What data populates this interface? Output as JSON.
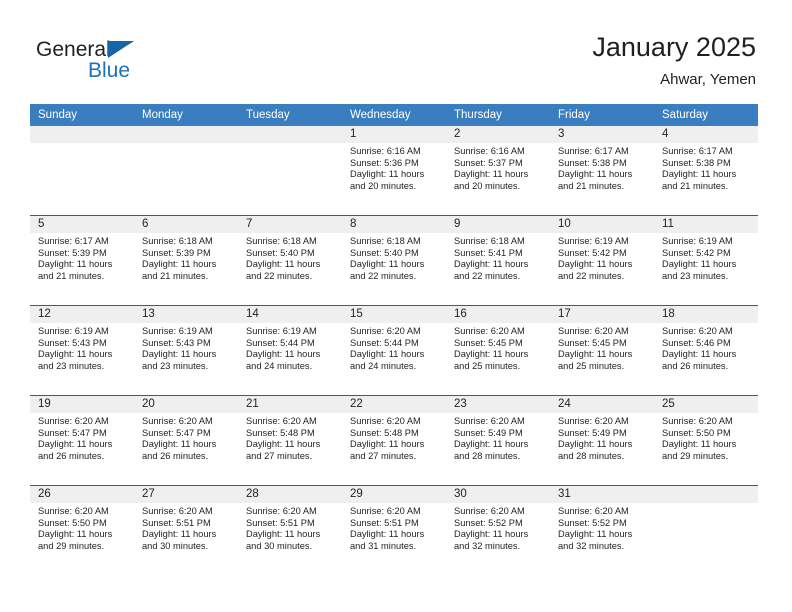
{
  "brand": {
    "name_part1": "General",
    "name_part2": "Blue",
    "triangle_icon": "triangle-icon"
  },
  "header": {
    "title": "January 2025",
    "location": "Ahwar, Yemen"
  },
  "colors": {
    "header_blue": "#3a7ec0",
    "rule_blue": "#1565a8",
    "band_gray": "#efefef",
    "text": "#231f20",
    "brand_blue": "#1d71b8"
  },
  "weekdays": [
    "Sunday",
    "Monday",
    "Tuesday",
    "Wednesday",
    "Thursday",
    "Friday",
    "Saturday"
  ],
  "calendar_data": {
    "month": "January",
    "year": 2025,
    "location": "Ahwar, Yemen",
    "weeks": [
      [
        {
          "day": "",
          "lines": [
            "",
            "",
            "",
            ""
          ]
        },
        {
          "day": "",
          "lines": [
            "",
            "",
            "",
            ""
          ]
        },
        {
          "day": "",
          "lines": [
            "",
            "",
            "",
            ""
          ]
        },
        {
          "day": "1",
          "lines": [
            "Sunrise: 6:16 AM",
            "Sunset: 5:36 PM",
            "Daylight: 11 hours",
            "and 20 minutes."
          ]
        },
        {
          "day": "2",
          "lines": [
            "Sunrise: 6:16 AM",
            "Sunset: 5:37 PM",
            "Daylight: 11 hours",
            "and 20 minutes."
          ]
        },
        {
          "day": "3",
          "lines": [
            "Sunrise: 6:17 AM",
            "Sunset: 5:38 PM",
            "Daylight: 11 hours",
            "and 21 minutes."
          ]
        },
        {
          "day": "4",
          "lines": [
            "Sunrise: 6:17 AM",
            "Sunset: 5:38 PM",
            "Daylight: 11 hours",
            "and 21 minutes."
          ]
        }
      ],
      [
        {
          "day": "5",
          "lines": [
            "Sunrise: 6:17 AM",
            "Sunset: 5:39 PM",
            "Daylight: 11 hours",
            "and 21 minutes."
          ]
        },
        {
          "day": "6",
          "lines": [
            "Sunrise: 6:18 AM",
            "Sunset: 5:39 PM",
            "Daylight: 11 hours",
            "and 21 minutes."
          ]
        },
        {
          "day": "7",
          "lines": [
            "Sunrise: 6:18 AM",
            "Sunset: 5:40 PM",
            "Daylight: 11 hours",
            "and 22 minutes."
          ]
        },
        {
          "day": "8",
          "lines": [
            "Sunrise: 6:18 AM",
            "Sunset: 5:40 PM",
            "Daylight: 11 hours",
            "and 22 minutes."
          ]
        },
        {
          "day": "9",
          "lines": [
            "Sunrise: 6:18 AM",
            "Sunset: 5:41 PM",
            "Daylight: 11 hours",
            "and 22 minutes."
          ]
        },
        {
          "day": "10",
          "lines": [
            "Sunrise: 6:19 AM",
            "Sunset: 5:42 PM",
            "Daylight: 11 hours",
            "and 22 minutes."
          ]
        },
        {
          "day": "11",
          "lines": [
            "Sunrise: 6:19 AM",
            "Sunset: 5:42 PM",
            "Daylight: 11 hours",
            "and 23 minutes."
          ]
        }
      ],
      [
        {
          "day": "12",
          "lines": [
            "Sunrise: 6:19 AM",
            "Sunset: 5:43 PM",
            "Daylight: 11 hours",
            "and 23 minutes."
          ]
        },
        {
          "day": "13",
          "lines": [
            "Sunrise: 6:19 AM",
            "Sunset: 5:43 PM",
            "Daylight: 11 hours",
            "and 23 minutes."
          ]
        },
        {
          "day": "14",
          "lines": [
            "Sunrise: 6:19 AM",
            "Sunset: 5:44 PM",
            "Daylight: 11 hours",
            "and 24 minutes."
          ]
        },
        {
          "day": "15",
          "lines": [
            "Sunrise: 6:20 AM",
            "Sunset: 5:44 PM",
            "Daylight: 11 hours",
            "and 24 minutes."
          ]
        },
        {
          "day": "16",
          "lines": [
            "Sunrise: 6:20 AM",
            "Sunset: 5:45 PM",
            "Daylight: 11 hours",
            "and 25 minutes."
          ]
        },
        {
          "day": "17",
          "lines": [
            "Sunrise: 6:20 AM",
            "Sunset: 5:45 PM",
            "Daylight: 11 hours",
            "and 25 minutes."
          ]
        },
        {
          "day": "18",
          "lines": [
            "Sunrise: 6:20 AM",
            "Sunset: 5:46 PM",
            "Daylight: 11 hours",
            "and 26 minutes."
          ]
        }
      ],
      [
        {
          "day": "19",
          "lines": [
            "Sunrise: 6:20 AM",
            "Sunset: 5:47 PM",
            "Daylight: 11 hours",
            "and 26 minutes."
          ]
        },
        {
          "day": "20",
          "lines": [
            "Sunrise: 6:20 AM",
            "Sunset: 5:47 PM",
            "Daylight: 11 hours",
            "and 26 minutes."
          ]
        },
        {
          "day": "21",
          "lines": [
            "Sunrise: 6:20 AM",
            "Sunset: 5:48 PM",
            "Daylight: 11 hours",
            "and 27 minutes."
          ]
        },
        {
          "day": "22",
          "lines": [
            "Sunrise: 6:20 AM",
            "Sunset: 5:48 PM",
            "Daylight: 11 hours",
            "and 27 minutes."
          ]
        },
        {
          "day": "23",
          "lines": [
            "Sunrise: 6:20 AM",
            "Sunset: 5:49 PM",
            "Daylight: 11 hours",
            "and 28 minutes."
          ]
        },
        {
          "day": "24",
          "lines": [
            "Sunrise: 6:20 AM",
            "Sunset: 5:49 PM",
            "Daylight: 11 hours",
            "and 28 minutes."
          ]
        },
        {
          "day": "25",
          "lines": [
            "Sunrise: 6:20 AM",
            "Sunset: 5:50 PM",
            "Daylight: 11 hours",
            "and 29 minutes."
          ]
        }
      ],
      [
        {
          "day": "26",
          "lines": [
            "Sunrise: 6:20 AM",
            "Sunset: 5:50 PM",
            "Daylight: 11 hours",
            "and 29 minutes."
          ]
        },
        {
          "day": "27",
          "lines": [
            "Sunrise: 6:20 AM",
            "Sunset: 5:51 PM",
            "Daylight: 11 hours",
            "and 30 minutes."
          ]
        },
        {
          "day": "28",
          "lines": [
            "Sunrise: 6:20 AM",
            "Sunset: 5:51 PM",
            "Daylight: 11 hours",
            "and 30 minutes."
          ]
        },
        {
          "day": "29",
          "lines": [
            "Sunrise: 6:20 AM",
            "Sunset: 5:51 PM",
            "Daylight: 11 hours",
            "and 31 minutes."
          ]
        },
        {
          "day": "30",
          "lines": [
            "Sunrise: 6:20 AM",
            "Sunset: 5:52 PM",
            "Daylight: 11 hours",
            "and 32 minutes."
          ]
        },
        {
          "day": "31",
          "lines": [
            "Sunrise: 6:20 AM",
            "Sunset: 5:52 PM",
            "Daylight: 11 hours",
            "and 32 minutes."
          ]
        },
        {
          "day": "",
          "lines": [
            "",
            "",
            "",
            ""
          ]
        }
      ]
    ]
  }
}
